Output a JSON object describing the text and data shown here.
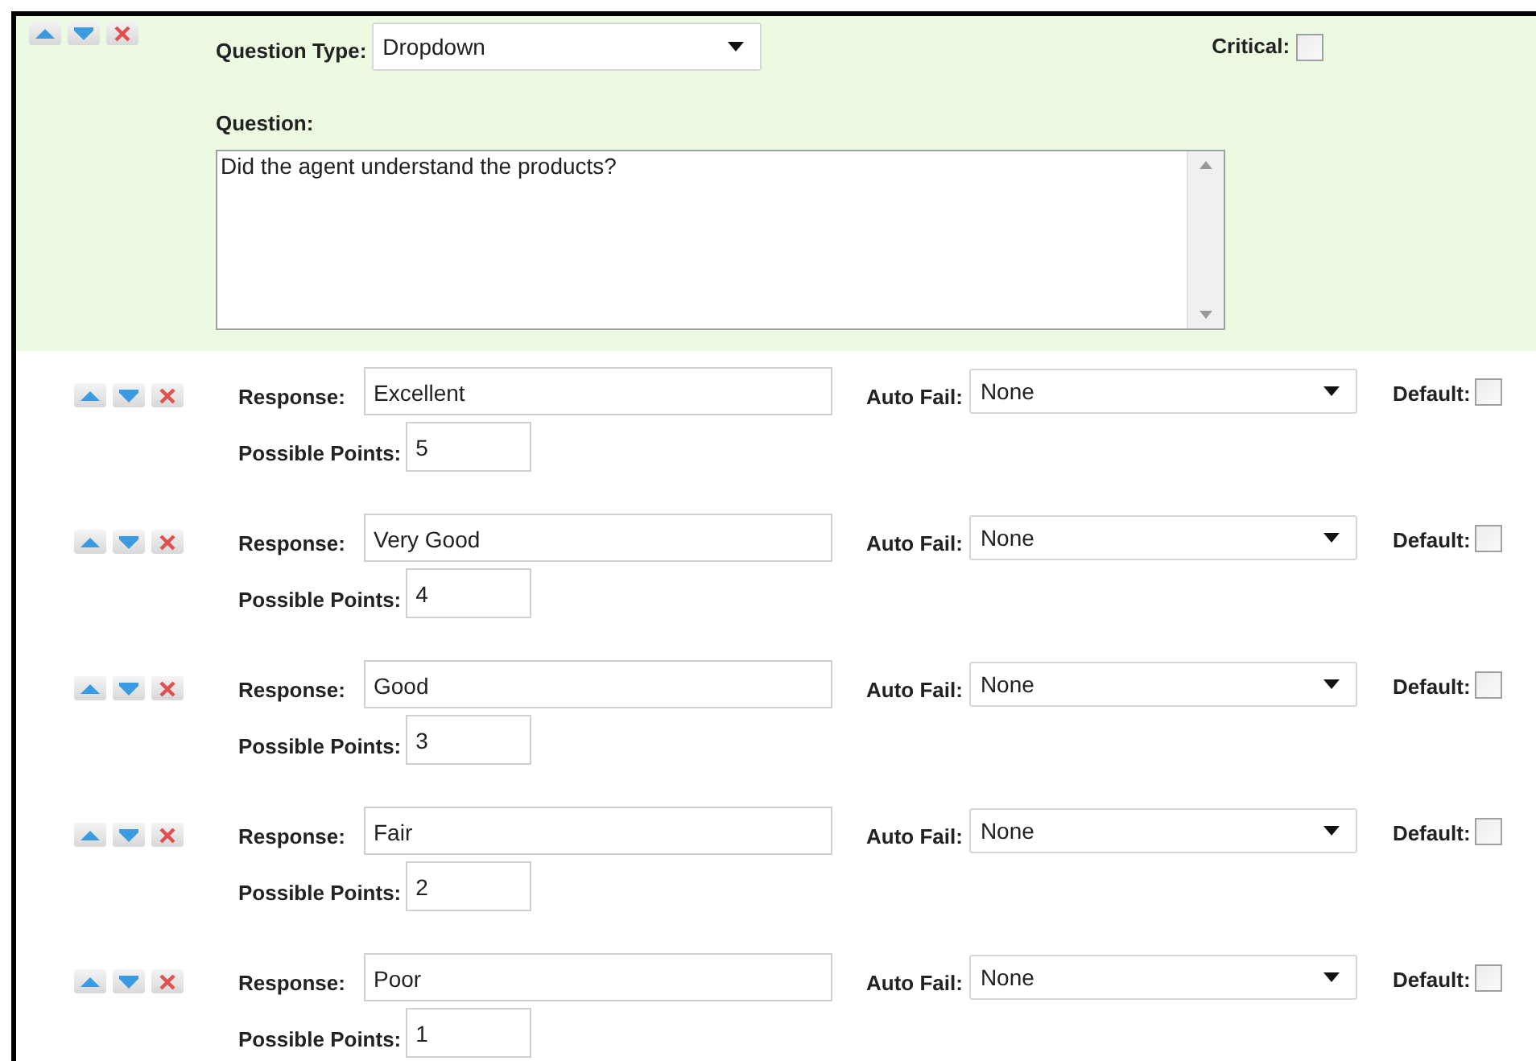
{
  "question_block": {
    "question_type_label": "Question Type:",
    "question_type": "Dropdown",
    "critical_label": "Critical:",
    "critical": false,
    "question_label": "Question:",
    "question": "Did the agent understand the products?"
  },
  "responses": [
    {
      "response_label": "Response:",
      "response": "Excellent",
      "auto_fail_label": "Auto Fail:",
      "auto_fail": "None",
      "default_label": "Default:",
      "default": false,
      "points_label": "Possible Points:",
      "points": "5"
    },
    {
      "response_label": "Response:",
      "response": "Very Good",
      "auto_fail_label": "Auto Fail:",
      "auto_fail": "None",
      "default_label": "Default:",
      "default": false,
      "points_label": "Possible Points:",
      "points": "4"
    },
    {
      "response_label": "Response:",
      "response": "Good",
      "auto_fail_label": "Auto Fail:",
      "auto_fail": "None",
      "default_label": "Default:",
      "default": false,
      "points_label": "Possible Points:",
      "points": "3"
    },
    {
      "response_label": "Response:",
      "response": "Fair",
      "auto_fail_label": "Auto Fail:",
      "auto_fail": "None",
      "default_label": "Default:",
      "default": false,
      "points_label": "Possible Points:",
      "points": "2"
    },
    {
      "response_label": "Response:",
      "response": "Poor",
      "auto_fail_label": "Auto Fail:",
      "auto_fail": "None",
      "default_label": "Default:",
      "default": false,
      "points_label": "Possible Points:",
      "points": "1"
    }
  ]
}
